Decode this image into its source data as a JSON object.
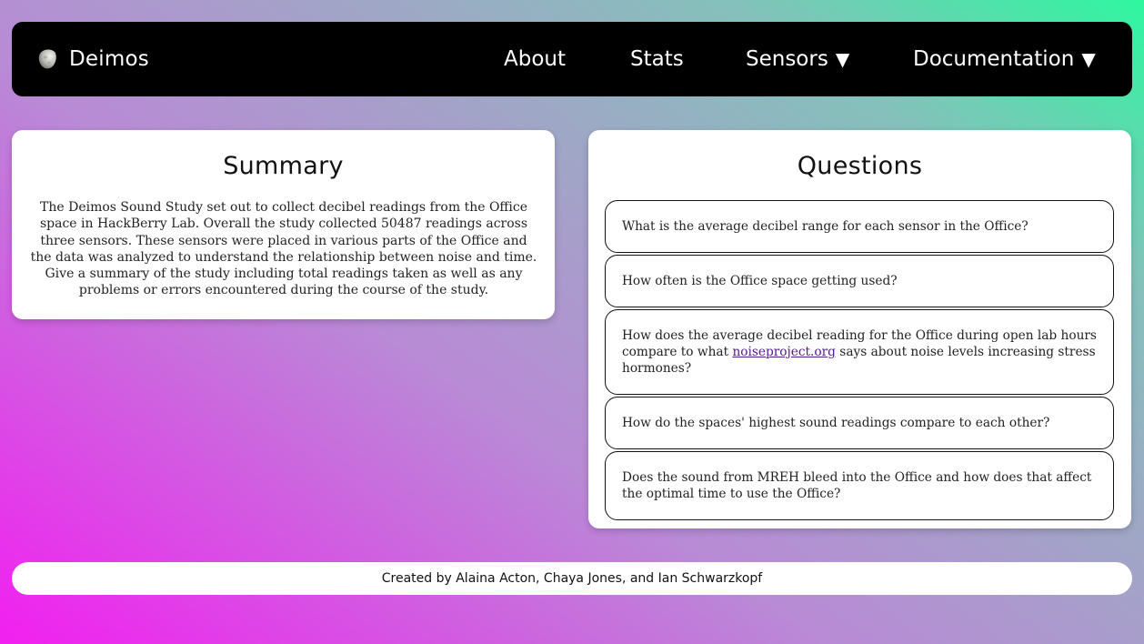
{
  "navbar": {
    "brand_name": "Deimos",
    "brand_icon": "deimos-moon-icon",
    "items": [
      {
        "label": "About"
      },
      {
        "label": "Stats"
      },
      {
        "label": "Sensors",
        "dropdown": true,
        "caret": "▼"
      },
      {
        "label": "Documentation",
        "dropdown": true,
        "caret": "▼"
      }
    ]
  },
  "summary": {
    "title": "Summary",
    "text": "The Deimos Sound Study set out to collect decibel readings from the Office space in HackBerry Lab. Overall the study collected 50487 readings across three sensors. These sensors were placed in various parts of the Office and the data was analyzed to understand the relationship between noise and time. Give a summary of the study including total readings taken as well as any problems or errors encountered during the course of the study."
  },
  "questions": {
    "title": "Questions",
    "items": [
      {
        "text": "What is the average decibel range for each sensor in the Office?"
      },
      {
        "text": "How often is the Office space getting used?"
      },
      {
        "text_before": "How does the average decibel reading for the Office during open lab hours compare to what ",
        "link_text": "noiseproject.org",
        "text_after": " says about noise levels increasing stress hormones?"
      },
      {
        "text": "How do the spaces' highest sound readings compare to each other?"
      },
      {
        "text": "Does the sound from MREH bleed into the Office and how does that affect the optimal time to use the Office?"
      }
    ]
  },
  "footer": {
    "credits": "Created by Alaina Acton, Chaya Jones, and Ian Schwarzkopf"
  },
  "colors": {
    "navbar_bg": "#000000",
    "card_bg": "#ffffff",
    "link": "#551a8b",
    "gradient_start": "#f21ff0",
    "gradient_end": "#2ef79f"
  }
}
